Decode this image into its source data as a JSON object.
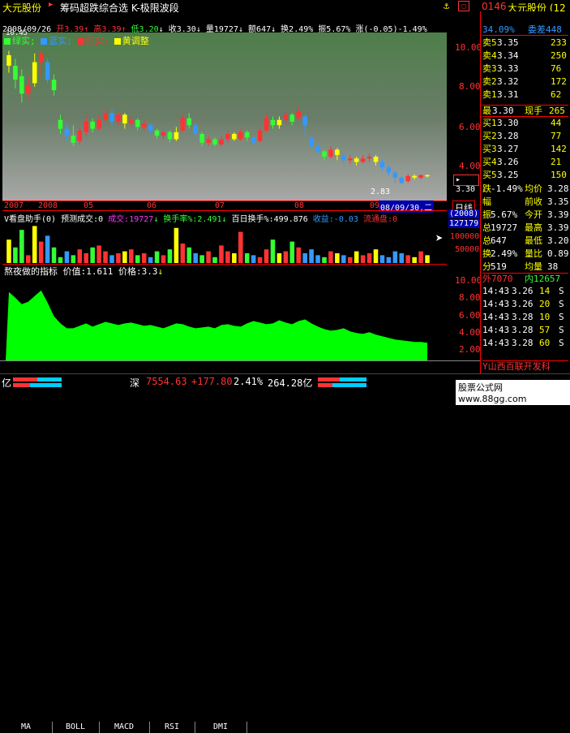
{
  "header": {
    "stock_name": "大元股份",
    "menu_title": "筹码超跌综合选 K-极限波段",
    "right_code": "0146",
    "right_name": "大元股份 (12"
  },
  "info_line": {
    "date": "2008/09/26",
    "open": "开3.39",
    "high": "高3.39",
    "low": "低3.20",
    "close": "收3.30",
    "volume": "量19727",
    "amount": "额647",
    "turnover": "换2.49%",
    "amplitude": "振5.67%",
    "change": "涨(-0.05)-1.49%"
  },
  "legend": {
    "items": [
      {
        "label": "绿实;",
        "color": "#33ff33"
      },
      {
        "label": "蓝实;",
        "color": "#3399ff"
      },
      {
        "label": "红实;",
        "color": "#ff3333"
      },
      {
        "label": "黄调整",
        "color": "#ffff00"
      }
    ],
    "top_value": "10.45"
  },
  "price_axis": [
    "10.00",
    "8.00",
    "6.00",
    "4.00"
  ],
  "current_price": "3.30",
  "low_marker": "2.83",
  "time_axis": [
    "2007",
    "2008",
    "05",
    "06",
    "07",
    "08",
    "09"
  ],
  "date_cursor": "08/09/30,二",
  "day_label": "日线",
  "volume_panel": {
    "title": "V看盘助手(0) 预测成交:0",
    "vol_label": "成交:19727",
    "turn_label": "换手率%:2.491",
    "hundred_label": "百日换手%:499.876",
    "income_label": "收益:-0.03",
    "flow_label": "流通盘:0",
    "year_box": "(2008)",
    "value_box": "127179",
    "scale": [
      "100000",
      "50000"
    ]
  },
  "indicator_panel": {
    "title": "熬夜做的指标",
    "value_label": "价值:1.611",
    "price_label": "价格:3.3",
    "scale": [
      "10.00",
      "8.00",
      "6.00",
      "4.00",
      "2.00"
    ]
  },
  "tabs": [
    "MA",
    "BOLL",
    "MACD",
    "RSI",
    "DMI"
  ],
  "status_bar": {
    "left_label": "亿",
    "market": "深",
    "index": "7554.63",
    "change": "+177.80",
    "pct": "2.41%",
    "amount": "264.28亿",
    "website": "股票公式网 www.88gg.com"
  },
  "quote_panel": {
    "weibi": "34.09%",
    "weicha": "委差448",
    "sell": [
      {
        "label": "卖5",
        "price": "3.35",
        "vol": "233"
      },
      {
        "label": "卖4",
        "price": "3.34",
        "vol": "250"
      },
      {
        "label": "卖3",
        "price": "3.33",
        "vol": "76"
      },
      {
        "label": "卖2",
        "price": "3.32",
        "vol": "172"
      },
      {
        "label": "卖1",
        "price": "3.31",
        "vol": "62"
      }
    ],
    "latest": {
      "label": "最",
      "price": "3.30",
      "vol_label": "现手",
      "vol": "265"
    },
    "buy": [
      {
        "label": "买1",
        "price": "3.30",
        "vol": "44"
      },
      {
        "label": "买2",
        "price": "3.28",
        "vol": "77"
      },
      {
        "label": "买3",
        "price": "3.27",
        "vol": "142"
      },
      {
        "label": "买4",
        "price": "3.26",
        "vol": "21"
      },
      {
        "label": "买5",
        "price": "3.25",
        "vol": "150"
      }
    ],
    "stats": [
      {
        "l": "跌",
        "lv": "-1.49%",
        "r": "均价",
        "rv": "3.28"
      },
      {
        "l": "幅",
        "lv": "",
        "r": "前收",
        "rv": "3.35"
      },
      {
        "l": "振",
        "lv": "5.67%",
        "r": "今开",
        "rv": "3.39"
      },
      {
        "l": "总",
        "lv": "19727",
        "r": "最高",
        "rv": "3.39"
      },
      {
        "l": "总",
        "lv": "647",
        "r": "最低",
        "rv": "3.20"
      },
      {
        "l": "换",
        "lv": "2.49%",
        "r": "量比",
        "rv": "0.89"
      },
      {
        "l": "分",
        "lv": "519",
        "r": "均量",
        "rv": "38"
      }
    ],
    "outer": "外7070",
    "inner": "内12657",
    "ticks": [
      {
        "t": "14:43",
        "p": "3.26",
        "v": "14",
        "d": "S"
      },
      {
        "t": "14:43",
        "p": "3.26",
        "v": "20",
        "d": "S"
      },
      {
        "t": "14:43",
        "p": "3.28",
        "v": "10",
        "d": "S"
      },
      {
        "t": "14:43",
        "p": "3.28",
        "v": "57",
        "d": "S"
      },
      {
        "t": "14:43",
        "p": "3.28",
        "v": "60",
        "d": "S"
      }
    ],
    "footer": "Y山西百联开发科"
  },
  "colors": {
    "up": "#ff3333",
    "down": "#33ff33",
    "yellow": "#ffff00",
    "blue": "#3399ff",
    "indicator_fill": "#00ff00"
  },
  "chart_data": {
    "type": "candlestick",
    "ylim": [
      2.5,
      11.5
    ],
    "candles": [
      {
        "o": 10.2,
        "c": 9.6,
        "h": 10.45,
        "l": 9.2,
        "col": "yellow"
      },
      {
        "o": 9.6,
        "c": 8.8,
        "h": 10.0,
        "l": 8.3,
        "col": "green"
      },
      {
        "o": 9.0,
        "c": 8.0,
        "h": 9.4,
        "l": 7.5,
        "col": "green"
      },
      {
        "o": 8.0,
        "c": 8.5,
        "h": 9.0,
        "l": 7.7,
        "col": "red"
      },
      {
        "o": 8.6,
        "c": 9.8,
        "h": 10.3,
        "l": 8.4,
        "col": "yellow"
      },
      {
        "o": 9.8,
        "c": 10.3,
        "h": 10.45,
        "l": 9.0,
        "col": "red"
      },
      {
        "o": 9.8,
        "c": 8.8,
        "h": 10.0,
        "l": 8.6,
        "col": "blue"
      },
      {
        "o": 8.8,
        "c": 8.2,
        "h": 9.1,
        "l": 7.9,
        "col": "green"
      },
      {
        "o": 6.5,
        "c": 6.0,
        "h": 6.8,
        "l": 5.7,
        "col": "green"
      },
      {
        "o": 6.0,
        "c": 5.6,
        "h": 6.3,
        "l": 5.3,
        "col": "blue"
      },
      {
        "o": 5.6,
        "c": 5.2,
        "h": 6.2,
        "l": 5.0,
        "col": "green"
      },
      {
        "o": 5.3,
        "c": 5.9,
        "h": 6.1,
        "l": 5.1,
        "col": "red"
      },
      {
        "o": 5.8,
        "c": 6.4,
        "h": 6.7,
        "l": 5.6,
        "col": "red"
      },
      {
        "o": 6.4,
        "c": 6.0,
        "h": 6.6,
        "l": 5.8,
        "col": "green"
      },
      {
        "o": 6.0,
        "c": 6.5,
        "h": 6.8,
        "l": 5.9,
        "col": "red"
      },
      {
        "o": 6.5,
        "c": 6.9,
        "h": 7.2,
        "l": 6.3,
        "col": "red"
      },
      {
        "o": 6.9,
        "c": 6.4,
        "h": 7.1,
        "l": 6.2,
        "col": "blue"
      },
      {
        "o": 6.4,
        "c": 6.8,
        "h": 7.0,
        "l": 6.2,
        "col": "red"
      },
      {
        "o": 6.8,
        "c": 6.3,
        "h": 6.9,
        "l": 6.0,
        "col": "yellow"
      },
      {
        "o": 6.3,
        "c": 6.5,
        "h": 6.7,
        "l": 6.1,
        "col": "red"
      },
      {
        "o": 6.5,
        "c": 6.1,
        "h": 6.6,
        "l": 5.9,
        "col": "green"
      },
      {
        "o": 6.1,
        "c": 6.3,
        "h": 6.5,
        "l": 5.9,
        "col": "red"
      },
      {
        "o": 6.2,
        "c": 5.9,
        "h": 6.3,
        "l": 5.7,
        "col": "blue"
      },
      {
        "o": 5.9,
        "c": 5.6,
        "h": 6.0,
        "l": 5.4,
        "col": "green"
      },
      {
        "o": 5.6,
        "c": 5.8,
        "h": 6.0,
        "l": 5.4,
        "col": "red"
      },
      {
        "o": 5.8,
        "c": 5.4,
        "h": 5.9,
        "l": 5.2,
        "col": "green"
      },
      {
        "o": 5.4,
        "c": 5.8,
        "h": 6.1,
        "l": 5.3,
        "col": "yellow"
      },
      {
        "o": 5.9,
        "c": 6.6,
        "h": 6.8,
        "l": 5.8,
        "col": "red"
      },
      {
        "o": 6.6,
        "c": 6.2,
        "h": 6.9,
        "l": 6.0,
        "col": "green"
      },
      {
        "o": 6.2,
        "c": 5.7,
        "h": 6.3,
        "l": 5.5,
        "col": "blue"
      },
      {
        "o": 5.7,
        "c": 5.2,
        "h": 5.8,
        "l": 5.0,
        "col": "green"
      },
      {
        "o": 5.2,
        "c": 5.4,
        "h": 5.6,
        "l": 5.0,
        "col": "red"
      },
      {
        "o": 5.4,
        "c": 5.1,
        "h": 5.5,
        "l": 5.0,
        "col": "green"
      },
      {
        "o": 5.1,
        "c": 5.4,
        "h": 5.6,
        "l": 5.0,
        "col": "red"
      },
      {
        "o": 5.4,
        "c": 5.7,
        "h": 5.9,
        "l": 5.2,
        "col": "red"
      },
      {
        "o": 5.7,
        "c": 5.4,
        "h": 5.8,
        "l": 5.3,
        "col": "yellow"
      },
      {
        "o": 5.4,
        "c": 5.8,
        "h": 6.0,
        "l": 5.3,
        "col": "red"
      },
      {
        "o": 5.8,
        "c": 5.5,
        "h": 5.9,
        "l": 5.3,
        "col": "green"
      },
      {
        "o": 5.5,
        "c": 5.2,
        "h": 5.6,
        "l": 5.0,
        "col": "blue"
      },
      {
        "o": 5.3,
        "c": 5.9,
        "h": 6.1,
        "l": 5.2,
        "col": "red"
      },
      {
        "o": 5.9,
        "c": 6.6,
        "h": 6.8,
        "l": 5.8,
        "col": "red"
      },
      {
        "o": 6.5,
        "c": 6.2,
        "h": 6.7,
        "l": 6.0,
        "col": "green"
      },
      {
        "o": 6.2,
        "c": 6.5,
        "h": 6.7,
        "l": 6.0,
        "col": "yellow"
      },
      {
        "o": 6.5,
        "c": 6.8,
        "h": 7.0,
        "l": 6.3,
        "col": "red"
      },
      {
        "o": 6.8,
        "c": 6.4,
        "h": 6.9,
        "l": 6.2,
        "col": "green"
      },
      {
        "o": 6.6,
        "c": 7.0,
        "h": 7.2,
        "l": 6.5,
        "col": "red"
      },
      {
        "o": 6.7,
        "c": 6.2,
        "h": 6.8,
        "l": 5.6,
        "col": "blue"
      },
      {
        "o": 5.5,
        "c": 5.0,
        "h": 5.6,
        "l": 4.8,
        "col": "blue"
      },
      {
        "o": 5.0,
        "c": 4.7,
        "h": 5.1,
        "l": 4.5,
        "col": "blue"
      },
      {
        "o": 4.7,
        "c": 4.4,
        "h": 4.8,
        "l": 4.2,
        "col": "green"
      },
      {
        "o": 4.4,
        "c": 4.8,
        "h": 5.0,
        "l": 4.3,
        "col": "red"
      },
      {
        "o": 4.8,
        "c": 4.5,
        "h": 4.9,
        "l": 4.2,
        "col": "yellow"
      },
      {
        "o": 4.5,
        "c": 4.2,
        "h": 4.6,
        "l": 4.0,
        "col": "blue"
      },
      {
        "o": 4.2,
        "c": 4.3,
        "h": 4.5,
        "l": 4.0,
        "col": "red"
      },
      {
        "o": 4.3,
        "c": 4.1,
        "h": 4.4,
        "l": 3.9,
        "col": "yellow"
      },
      {
        "o": 4.1,
        "c": 4.3,
        "h": 4.5,
        "l": 4.0,
        "col": "red"
      },
      {
        "o": 4.3,
        "c": 4.4,
        "h": 4.6,
        "l": 4.1,
        "col": "red"
      },
      {
        "o": 4.4,
        "c": 4.1,
        "h": 4.5,
        "l": 3.9,
        "col": "yellow"
      },
      {
        "o": 4.1,
        "c": 3.8,
        "h": 4.2,
        "l": 3.6,
        "col": "blue"
      },
      {
        "o": 3.8,
        "c": 3.5,
        "h": 3.9,
        "l": 3.3,
        "col": "blue"
      },
      {
        "o": 3.5,
        "c": 3.2,
        "h": 3.6,
        "l": 2.9,
        "col": "blue"
      },
      {
        "o": 3.2,
        "c": 2.9,
        "h": 3.3,
        "l": 2.83,
        "col": "blue"
      },
      {
        "o": 3.0,
        "c": 3.3,
        "h": 3.4,
        "l": 2.9,
        "col": "red"
      },
      {
        "o": 3.3,
        "c": 3.2,
        "h": 3.4,
        "l": 3.1,
        "col": "yellow"
      },
      {
        "o": 3.2,
        "c": 3.35,
        "h": 3.4,
        "l": 3.1,
        "col": "red"
      },
      {
        "o": 3.35,
        "c": 3.3,
        "h": 3.39,
        "l": 3.2,
        "col": "yellow"
      }
    ],
    "volume": [
      60,
      40,
      85,
      20,
      95,
      55,
      70,
      40,
      15,
      30,
      20,
      35,
      25,
      40,
      45,
      30,
      20,
      25,
      30,
      35,
      20,
      25,
      15,
      30,
      20,
      35,
      90,
      50,
      40,
      25,
      20,
      30,
      15,
      45,
      30,
      25,
      80,
      25,
      20,
      15,
      35,
      60,
      25,
      30,
      55,
      40,
      25,
      35,
      20,
      15,
      30,
      25,
      20,
      15,
      30,
      20,
      25,
      35,
      20,
      15,
      30,
      25,
      20,
      15,
      30,
      20
    ],
    "indicator": [
      9.5,
      8.8,
      8.0,
      8.3,
      9.0,
      9.7,
      8.2,
      6.5,
      5.6,
      5.0,
      5.0,
      5.3,
      5.6,
      5.2,
      5.5,
      5.8,
      5.6,
      5.4,
      5.6,
      5.7,
      5.5,
      5.3,
      5.4,
      5.2,
      5.0,
      5.3,
      5.6,
      5.5,
      5.2,
      5.0,
      5.1,
      5.2,
      5.0,
      5.4,
      5.5,
      5.3,
      5.2,
      5.6,
      5.9,
      5.7,
      5.5,
      5.6,
      6.0,
      5.7,
      5.5,
      5.9,
      6.1,
      5.6,
      5.2,
      4.9,
      4.7,
      4.8,
      5.0,
      4.6,
      4.4,
      4.3,
      4.5,
      4.2,
      4.0,
      3.8,
      3.6,
      3.5,
      3.4,
      3.3,
      3.3,
      3.2
    ]
  }
}
